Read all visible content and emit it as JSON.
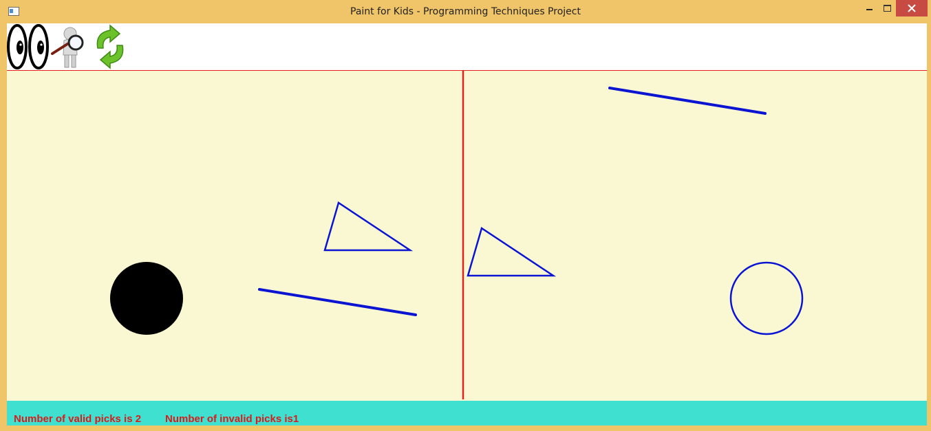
{
  "window": {
    "title": "Paint for Kids - Programming Techniques Project",
    "buttons": [
      "minimize",
      "maximize",
      "close"
    ]
  },
  "toolbar": {
    "tools": [
      {
        "name": "eyes-icon",
        "meaning": "play mode - pick by figure"
      },
      {
        "name": "magnifier-person-icon",
        "meaning": "pick / find"
      },
      {
        "name": "restart-icon",
        "meaning": "restart / refresh"
      }
    ]
  },
  "canvas": {
    "background": "#f9f8d3",
    "divider_color": "#e0201a",
    "stroke_color": "#0a14d2",
    "fill_color": "#000000",
    "shapes": [
      "filled-circle",
      "line",
      "triangle",
      "triangle",
      "line",
      "circle"
    ]
  },
  "status": {
    "valid_picks": "Number of valid picks is 2",
    "invalid_picks": "Number of invalid picks is1",
    "text_color": "#d81c1c",
    "background": "#40e0d0"
  }
}
